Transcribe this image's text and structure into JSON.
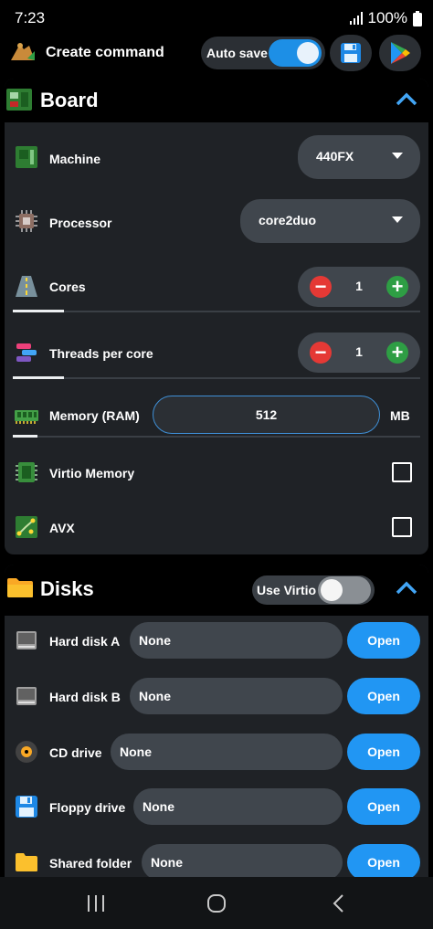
{
  "status_bar": {
    "time": "7:23",
    "battery": "100%"
  },
  "toolbar": {
    "title": "Create command",
    "autosave_label": "Auto save",
    "autosave_on": true
  },
  "board": {
    "title": "Board",
    "machine": {
      "label": "Machine",
      "value": "440FX"
    },
    "processor": {
      "label": "Processor",
      "value": "core2duo"
    },
    "cores": {
      "label": "Cores",
      "value": "1",
      "slider_fraction": 0.125
    },
    "threads": {
      "label": "Threads per core",
      "value": "1",
      "slider_fraction": 0.125
    },
    "memory": {
      "label": "Memory (RAM)",
      "value": "512",
      "unit": "MB",
      "slider_fraction": 0.06
    },
    "virtio_memory": {
      "label": "Virtio Memory",
      "checked": false
    },
    "avx": {
      "label": "AVX",
      "checked": false
    }
  },
  "disks": {
    "title": "Disks",
    "use_virtio_label": "Use Virtio",
    "use_virtio_on": false,
    "open_label": "Open",
    "items": [
      {
        "label": "Hard disk A",
        "value": "None"
      },
      {
        "label": "Hard disk B",
        "value": "None"
      },
      {
        "label": "CD drive",
        "value": "None"
      },
      {
        "label": "Floppy drive",
        "value": "None"
      },
      {
        "label": "Shared folder",
        "value": "None"
      }
    ]
  },
  "colors": {
    "accent": "#2196f3",
    "card": "#1f2226",
    "minus": "#e53935",
    "plus": "#2e9e44"
  }
}
